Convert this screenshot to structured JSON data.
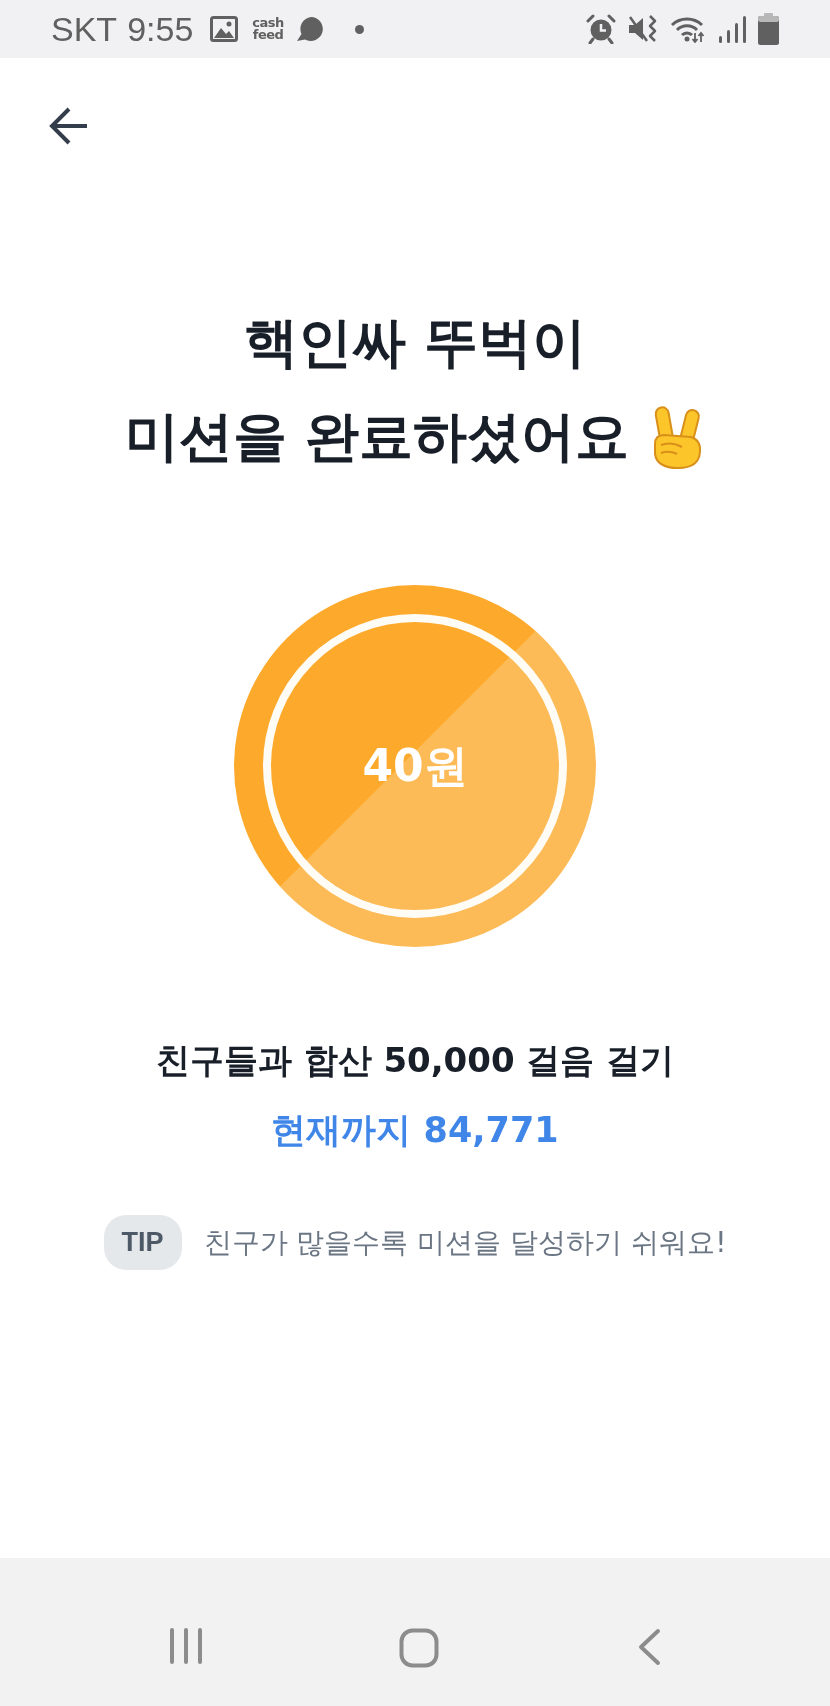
{
  "status_bar": {
    "carrier": "SKT",
    "time": "9:55",
    "app_logo": "cash feed"
  },
  "title": [
    "핵인싸 뚜벅이",
    "미션을 완료하셨어요"
  ],
  "reward": {
    "amount": "40원"
  },
  "mission": {
    "goal": "친구들과 합산 50,000 걸음 걸기",
    "progress": "현재까지 84,771"
  },
  "tip": {
    "badge": "TIP",
    "text": "친구가 많을수록 미션을 달성하기 쉬워요!"
  }
}
